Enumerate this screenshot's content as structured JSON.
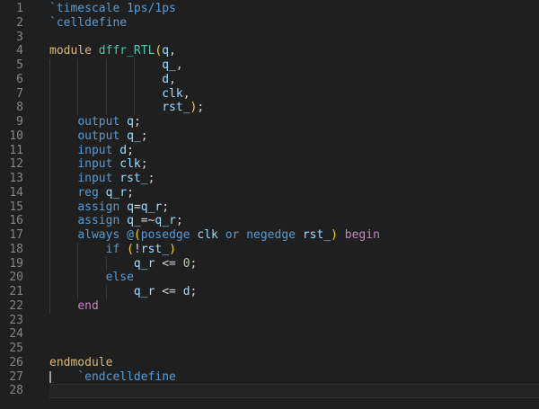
{
  "editor": {
    "language": "verilog",
    "background": "#1f1f1f",
    "gutter_color": "#858585",
    "guide_color": "#383838",
    "cursor_color": "#9e9e9e",
    "cursor": {
      "line": 27,
      "col": 0
    },
    "active_line": 28,
    "token_colors": {
      "dir": "#569CD6",
      "kw": "#569CD6",
      "ctl": "#C586C0",
      "mod": "#D7BA7D",
      "typ": "#4EC9B0",
      "var": "#9CDCFE",
      "num": "#B5CEA8",
      "pun": "#D4D4D4",
      "brk": "#FFD700",
      "pln": "#D4D4D4"
    },
    "indent_guides": {
      "5": [
        0,
        4,
        8,
        12
      ],
      "6": [
        0,
        4,
        8,
        12
      ],
      "7": [
        0,
        4,
        8,
        12
      ],
      "8": [
        0,
        4,
        8,
        12
      ],
      "9": [
        0
      ],
      "10": [
        0
      ],
      "11": [
        0
      ],
      "12": [
        0
      ],
      "13": [
        0
      ],
      "14": [
        0
      ],
      "15": [
        0
      ],
      "16": [
        0
      ],
      "17": [
        0
      ],
      "18": [
        0,
        4
      ],
      "19": [
        0,
        4,
        8
      ],
      "20": [
        0,
        4
      ],
      "21": [
        0,
        4,
        8
      ],
      "22": [
        0
      ]
    },
    "lines": [
      {
        "n": 1,
        "t": [
          [
            "`timescale 1ps/1ps",
            "dir"
          ]
        ]
      },
      {
        "n": 2,
        "t": [
          [
            "`celldefine",
            "dir"
          ]
        ]
      },
      {
        "n": 3,
        "t": []
      },
      {
        "n": 4,
        "t": [
          [
            "module",
            "mod"
          ],
          [
            " ",
            "pln"
          ],
          [
            "dffr_RTL",
            "typ"
          ],
          [
            "(",
            "brk"
          ],
          [
            "q",
            "var"
          ],
          [
            ",",
            "pun"
          ]
        ]
      },
      {
        "n": 5,
        "t": [
          [
            "                ",
            "pln"
          ],
          [
            "q_",
            "var"
          ],
          [
            ",",
            "pun"
          ]
        ]
      },
      {
        "n": 6,
        "t": [
          [
            "                ",
            "pln"
          ],
          [
            "d",
            "var"
          ],
          [
            ",",
            "pun"
          ]
        ]
      },
      {
        "n": 7,
        "t": [
          [
            "                ",
            "pln"
          ],
          [
            "clk",
            "var"
          ],
          [
            ",",
            "pun"
          ]
        ]
      },
      {
        "n": 8,
        "t": [
          [
            "                ",
            "pln"
          ],
          [
            "rst_",
            "var"
          ],
          [
            ")",
            "brk"
          ],
          [
            ";",
            "pun"
          ]
        ]
      },
      {
        "n": 9,
        "t": [
          [
            "    ",
            "pln"
          ],
          [
            "output",
            "kw"
          ],
          [
            " ",
            "pln"
          ],
          [
            "q",
            "var"
          ],
          [
            ";",
            "pun"
          ]
        ]
      },
      {
        "n": 10,
        "t": [
          [
            "    ",
            "pln"
          ],
          [
            "output",
            "kw"
          ],
          [
            " ",
            "pln"
          ],
          [
            "q_",
            "var"
          ],
          [
            ";",
            "pun"
          ]
        ]
      },
      {
        "n": 11,
        "t": [
          [
            "    ",
            "pln"
          ],
          [
            "input",
            "kw"
          ],
          [
            " ",
            "pln"
          ],
          [
            "d",
            "var"
          ],
          [
            ";",
            "pun"
          ]
        ]
      },
      {
        "n": 12,
        "t": [
          [
            "    ",
            "pln"
          ],
          [
            "input",
            "kw"
          ],
          [
            " ",
            "pln"
          ],
          [
            "clk",
            "var"
          ],
          [
            ";",
            "pun"
          ]
        ]
      },
      {
        "n": 13,
        "t": [
          [
            "    ",
            "pln"
          ],
          [
            "input",
            "kw"
          ],
          [
            " ",
            "pln"
          ],
          [
            "rst_",
            "var"
          ],
          [
            ";",
            "pun"
          ]
        ]
      },
      {
        "n": 14,
        "t": [
          [
            "    ",
            "pln"
          ],
          [
            "reg",
            "kw"
          ],
          [
            " ",
            "pln"
          ],
          [
            "q_r",
            "var"
          ],
          [
            ";",
            "pun"
          ]
        ]
      },
      {
        "n": 15,
        "t": [
          [
            "    ",
            "pln"
          ],
          [
            "assign",
            "kw"
          ],
          [
            " ",
            "pln"
          ],
          [
            "q",
            "var"
          ],
          [
            "=",
            "pun"
          ],
          [
            "q_r",
            "var"
          ],
          [
            ";",
            "pun"
          ]
        ]
      },
      {
        "n": 16,
        "t": [
          [
            "    ",
            "pln"
          ],
          [
            "assign",
            "kw"
          ],
          [
            " ",
            "pln"
          ],
          [
            "q_",
            "var"
          ],
          [
            "=~",
            "pun"
          ],
          [
            "q_r",
            "var"
          ],
          [
            ";",
            "pun"
          ]
        ]
      },
      {
        "n": 17,
        "t": [
          [
            "    ",
            "pln"
          ],
          [
            "always",
            "kw"
          ],
          [
            " ",
            "pln"
          ],
          [
            "@",
            "kw"
          ],
          [
            "(",
            "brk"
          ],
          [
            "posedge",
            "kw"
          ],
          [
            " ",
            "pln"
          ],
          [
            "clk",
            "var"
          ],
          [
            " ",
            "pln"
          ],
          [
            "or",
            "kw"
          ],
          [
            " ",
            "pln"
          ],
          [
            "negedge",
            "kw"
          ],
          [
            " ",
            "pln"
          ],
          [
            "rst_",
            "var"
          ],
          [
            ")",
            "brk"
          ],
          [
            " ",
            "pln"
          ],
          [
            "begin",
            "ctl"
          ]
        ]
      },
      {
        "n": 18,
        "t": [
          [
            "        ",
            "pln"
          ],
          [
            "if",
            "kw"
          ],
          [
            " ",
            "pln"
          ],
          [
            "(",
            "brk"
          ],
          [
            "!",
            "pun"
          ],
          [
            "rst_",
            "var"
          ],
          [
            ")",
            "brk"
          ]
        ]
      },
      {
        "n": 19,
        "t": [
          [
            "            ",
            "pln"
          ],
          [
            "q_r",
            "var"
          ],
          [
            " ",
            "pln"
          ],
          [
            "<=",
            "pun"
          ],
          [
            " ",
            "pln"
          ],
          [
            "0",
            "num"
          ],
          [
            ";",
            "pun"
          ]
        ]
      },
      {
        "n": 20,
        "t": [
          [
            "        ",
            "pln"
          ],
          [
            "else",
            "kw"
          ]
        ]
      },
      {
        "n": 21,
        "t": [
          [
            "            ",
            "pln"
          ],
          [
            "q_r",
            "var"
          ],
          [
            " ",
            "pln"
          ],
          [
            "<=",
            "pun"
          ],
          [
            " ",
            "pln"
          ],
          [
            "d",
            "var"
          ],
          [
            ";",
            "pun"
          ]
        ]
      },
      {
        "n": 22,
        "t": [
          [
            "    ",
            "pln"
          ],
          [
            "end",
            "ctl"
          ]
        ]
      },
      {
        "n": 23,
        "t": []
      },
      {
        "n": 24,
        "t": []
      },
      {
        "n": 25,
        "t": []
      },
      {
        "n": 26,
        "t": [
          [
            "endmodule",
            "mod"
          ]
        ]
      },
      {
        "n": 27,
        "t": [
          [
            "    ",
            "pln"
          ],
          [
            "`endcelldefine",
            "dir"
          ]
        ]
      },
      {
        "n": 28,
        "t": []
      }
    ]
  }
}
